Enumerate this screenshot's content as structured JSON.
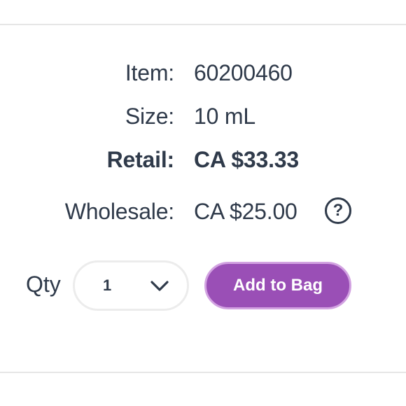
{
  "details": {
    "item_label": "Item:",
    "item_value": "60200460",
    "size_label": "Size:",
    "size_value": "10 mL",
    "retail_label": "Retail:",
    "retail_value": "CA $33.33",
    "wholesale_label": "Wholesale:",
    "wholesale_value": "CA $25.00",
    "help_symbol": "?"
  },
  "purchase": {
    "qty_label": "Qty",
    "qty_selected": "1",
    "add_button_label": "Add to Bag"
  },
  "colors": {
    "text": "#2f3a4a",
    "button_bg": "#9a4fb6",
    "button_border": "#d2a2e1",
    "divider": "#e6e6e6"
  },
  "icons": {
    "help": "question-circle-icon",
    "dropdown": "chevron-down-icon"
  }
}
